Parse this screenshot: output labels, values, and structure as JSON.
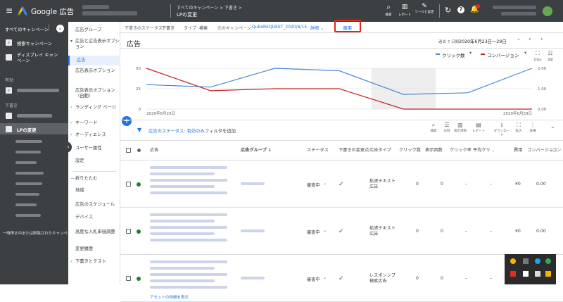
{
  "topbar": {
    "product": "Google 広告",
    "breadcrumb": "すべてのキャンペーン > 下書き >",
    "page_title": "LPの変更",
    "tools": [
      {
        "icon": "search-icon",
        "label": "検索"
      },
      {
        "icon": "report-icon",
        "label": "レポート"
      },
      {
        "icon": "wrench-icon",
        "label": "ツールと設定"
      }
    ]
  },
  "leftnav": {
    "all_campaigns": "すべてのキャンペーン",
    "campaigns": [
      {
        "label": "検索キャンペーン"
      },
      {
        "label": "ディスプレイ キャンペーン"
      }
    ],
    "section_active": "有効",
    "section_draft": "下書き",
    "draft_selected": "LPの変更",
    "footer": "一時停止中または削除されたキャンペーン"
  },
  "subnav": [
    {
      "label": "広告グループ",
      "arrow": ""
    },
    {
      "label": "広告と広告表示オプション",
      "arrow": "▾"
    },
    {
      "label": "広告",
      "arrow": "",
      "active": true
    },
    {
      "label": "広告表示オプション",
      "arrow": ""
    },
    {
      "label": "広告表示オプション（自動）",
      "arrow": ""
    },
    {
      "label": "ランディング ページ",
      "arrow": "›"
    },
    {
      "label": "キーワード",
      "arrow": "›"
    },
    {
      "label": "オーディエンス",
      "arrow": "›"
    },
    {
      "label": "ユーザー属性",
      "arrow": "›"
    },
    {
      "label": "設定",
      "arrow": ""
    },
    {
      "label": "折りたたむ",
      "arrow": "—"
    },
    {
      "label": "地域",
      "arrow": ""
    },
    {
      "label": "広告のスケジュール",
      "arrow": ""
    },
    {
      "label": "デバイス",
      "arrow": ""
    },
    {
      "label": "高度な入札単価調整",
      "arrow": ""
    },
    {
      "label": "変更履歴",
      "arrow": ""
    },
    {
      "label": "下書きとテスト",
      "arrow": "›"
    }
  ],
  "draftbar": {
    "status_label": "下書きのステータス:",
    "status_value": "下書き",
    "type_label": "タイプ:",
    "type_value": "検索",
    "origin_label": "元のキャンペーン:",
    "origin_value": "QuboREQUEST_2020/6/15",
    "details": "詳細",
    "apply": "適用"
  },
  "ads_header": {
    "title": "広告",
    "range_label": "過去 7 日間",
    "range_value": "2020年6月23日～29日"
  },
  "chart_data": {
    "type": "line",
    "x": [
      "2020年6月23日",
      "",
      "",
      "",
      "",
      "",
      "2020年6月29日"
    ],
    "series": [
      {
        "name": "クリック数",
        "color": "#4a87d6",
        "values": [
          30,
          27,
          50,
          47,
          18,
          20,
          50
        ]
      },
      {
        "name": "コンバージョン",
        "color": "#c5221f",
        "values": [
          2.0,
          0.9,
          1.0,
          1.0,
          0,
          0,
          0
        ]
      }
    ],
    "left_ticks": [
      "50",
      "25",
      "0"
    ],
    "right_ticks": [
      "2.00",
      "1.00",
      "0.00"
    ],
    "left_ylim": [
      0,
      50
    ],
    "right_ylim": [
      0,
      2
    ],
    "x_tick_labels": [
      "2020年6月23日",
      "2020年6月29日"
    ],
    "shaded_category_index": 4
  },
  "chart_controls": {
    "metric1": "クリック数",
    "metric2": "コンバージョン",
    "hide": "非表示",
    "adjust": "調整"
  },
  "filterbar": {
    "filter_status": "広告のステータス: 有効のみ",
    "add_filter": "フィルタを追加",
    "tools": [
      {
        "icon": "search-icon",
        "label": "検索"
      },
      {
        "icon": "segment-icon",
        "label": "分割"
      },
      {
        "icon": "columns-icon",
        "label": "表示項目"
      },
      {
        "icon": "report-icon",
        "label": "レポート"
      },
      {
        "icon": "download-icon",
        "label": "ダウンロード"
      },
      {
        "icon": "expand-icon",
        "label": "拡大"
      },
      {
        "icon": "more-icon",
        "label": "詳細"
      }
    ]
  },
  "table": {
    "headers": [
      "広告",
      "広告グループ",
      "ステータス",
      "下書きの変更点",
      "広告タイプ",
      "クリック数",
      "表示回数",
      "クリック率",
      "平均クリック単価",
      "費用",
      "コンバージョン",
      "コンバージョン率"
    ],
    "headers_visible": [
      "広告",
      "広告グループ ↓",
      "ステータス",
      "下書きの変更点",
      "広告タイプ",
      "クリック数",
      "表示回数",
      "クリック率",
      "平均クリ...",
      "費用",
      "コンバージョ...",
      "コン..."
    ],
    "rows": [
      {
        "status": "審査中",
        "change": "✓",
        "type": "拡張テキスト 広告",
        "clicks": "0",
        "impr": "0",
        "ctr": "–",
        "cpc": "–",
        "cost": "¥0",
        "conv": "0.00"
      },
      {
        "status": "審査中",
        "change": "✓",
        "type": "拡張テキスト 広告",
        "clicks": "0",
        "impr": "0",
        "ctr": "–",
        "cpc": "–",
        "cost": "¥0",
        "conv": "0.00"
      },
      {
        "status": "審査中",
        "change": "✓",
        "type": "レスポンシブ 検索広告",
        "clicks": "0",
        "impr": "0",
        "ctr": "–",
        "cpc": "–",
        "cost": "¥0",
        "conv": "0.00"
      }
    ],
    "view_asset_link": "アセットの詳細を表示"
  }
}
